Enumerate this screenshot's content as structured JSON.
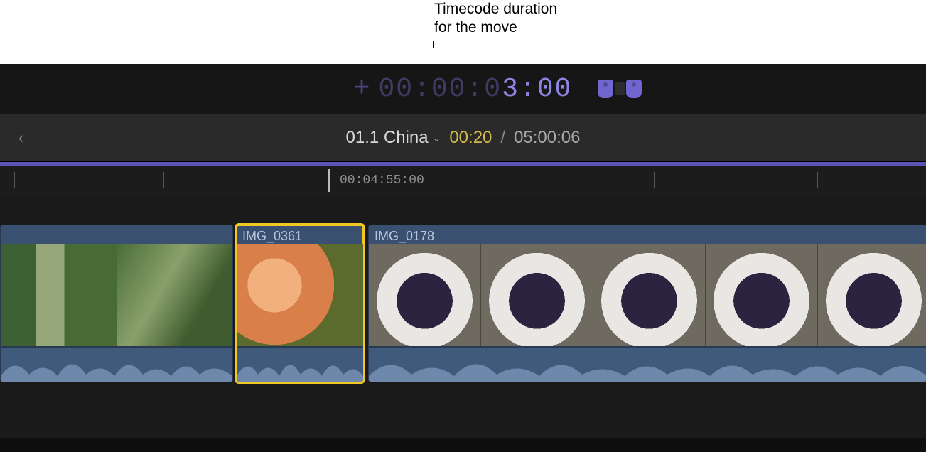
{
  "annotation": {
    "line1": "Timecode duration",
    "line2": "for the move"
  },
  "timecode_entry": {
    "sign": "+",
    "dim_prefix": "00:00:0",
    "active": "3:00"
  },
  "project_bar": {
    "name": "01.1 China",
    "current": "00:20",
    "separator": "/",
    "total": "05:00:06"
  },
  "ruler": {
    "playhead_label": "00:04:55:00"
  },
  "clips": [
    {
      "label": "",
      "name": "clip-vegetables-left"
    },
    {
      "label": "IMG_0361",
      "name": "clip-img-0361",
      "selected": true
    },
    {
      "label": "IMG_0178",
      "name": "clip-img-0178"
    }
  ]
}
